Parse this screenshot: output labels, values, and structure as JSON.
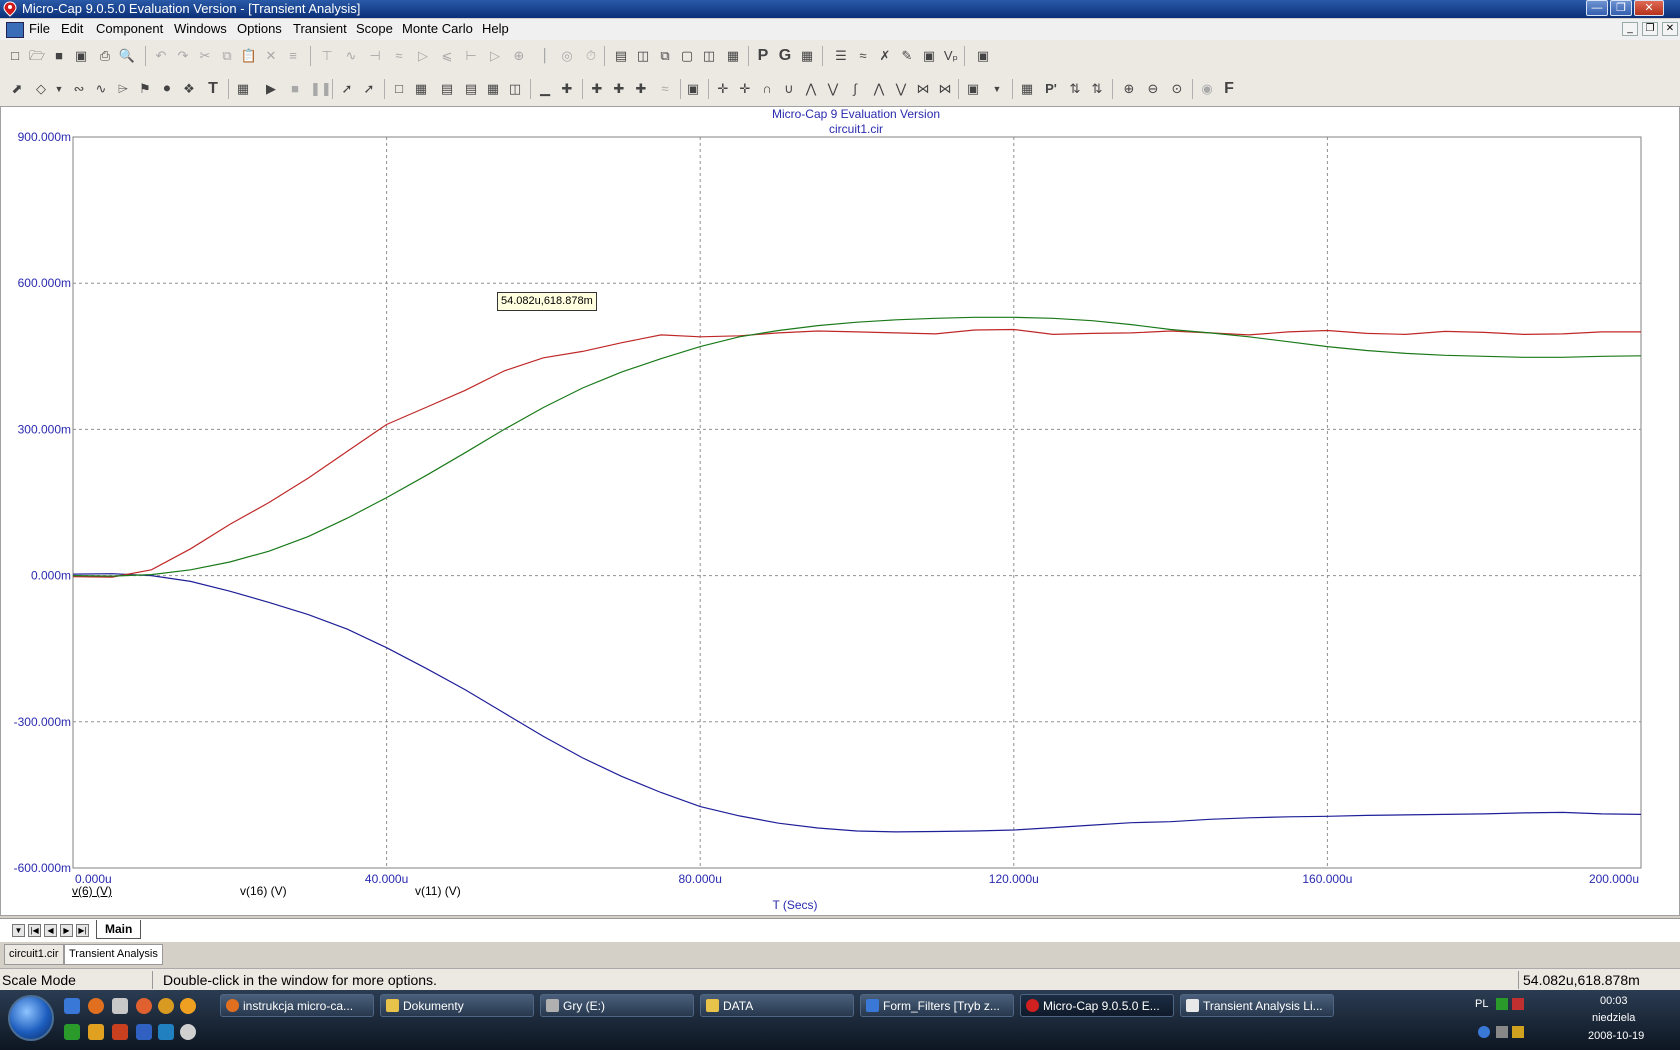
{
  "window": {
    "title": "Micro-Cap 9.0.5.0 Evaluation Version - [Transient Analysis]",
    "controls": [
      "minimize-icon",
      "restore-icon",
      "close-icon"
    ]
  },
  "menu": [
    "File",
    "Edit",
    "Component",
    "Windows",
    "Options",
    "Transient",
    "Scope",
    "Monte Carlo",
    "Help"
  ],
  "plot": {
    "header_line1": "Micro-Cap 9 Evaluation Version",
    "header_line2": "circuit1.cir",
    "cursor_tooltip": "54.082u,618.878m",
    "x_axis_title": "T (Secs)",
    "legend": [
      {
        "label": "v(6) (V)",
        "color": "#2020a0"
      },
      {
        "label": "v(16) (V)",
        "color": "#c03030"
      },
      {
        "label": "v(11) (V)",
        "color": "#208020"
      }
    ]
  },
  "chart_data": {
    "type": "line",
    "title": "Micro-Cap 9 Evaluation Version",
    "subtitle": "circuit1.cir",
    "xlabel": "T (Secs)",
    "ylabel": "",
    "xlim": [
      0,
      200
    ],
    "ylim": [
      -600,
      900
    ],
    "x_unit": "u",
    "y_unit": "m",
    "x_ticks": [
      "0.000u",
      "40.000u",
      "80.000u",
      "120.000u",
      "160.000u",
      "200.000u"
    ],
    "x_tick_values": [
      0,
      40,
      80,
      120,
      160,
      200
    ],
    "y_ticks": [
      "900.000m",
      "600.000m",
      "300.000m",
      "0.000m",
      "-300.000m",
      "-600.000m"
    ],
    "y_tick_values": [
      900,
      600,
      300,
      0,
      -300,
      -600
    ],
    "grid": true,
    "series": [
      {
        "name": "v(6) (V)",
        "color": "#1f1f99",
        "x": [
          0,
          5,
          10,
          15,
          20,
          25,
          30,
          35,
          40,
          45,
          50,
          55,
          60,
          65,
          70,
          75,
          80,
          85,
          90,
          95,
          100,
          105,
          110,
          115,
          120,
          125,
          130,
          135,
          140,
          145,
          150,
          155,
          160,
          165,
          170,
          175,
          180,
          185,
          190,
          195,
          200
        ],
        "y": [
          3,
          4,
          0,
          -12,
          -32,
          -55,
          -80,
          -110,
          -148,
          -190,
          -234,
          -282,
          -330,
          -374,
          -412,
          -445,
          -474,
          -493,
          -508,
          -518,
          -524,
          -526,
          -525,
          -524,
          -522,
          -517,
          -512,
          -507,
          -505,
          -500,
          -497,
          -495,
          -494,
          -492,
          -491,
          -490,
          -489,
          -487,
          -486,
          -489,
          -490
        ]
      },
      {
        "name": "v(16) (V)",
        "color": "#c02828",
        "x": [
          0,
          5,
          10,
          15,
          20,
          25,
          30,
          35,
          40,
          45,
          50,
          55,
          60,
          65,
          70,
          75,
          80,
          85,
          90,
          95,
          100,
          105,
          110,
          115,
          120,
          125,
          130,
          135,
          140,
          145,
          150,
          155,
          160,
          165,
          170,
          175,
          180,
          185,
          190,
          195,
          200
        ],
        "y": [
          -2,
          -3,
          12,
          55,
          105,
          150,
          200,
          255,
          310,
          345,
          380,
          420,
          447,
          460,
          478,
          494,
          490,
          492,
          498,
          502,
          500,
          498,
          496,
          504,
          505,
          495,
          497,
          498,
          502,
          498,
          494,
          500,
          503,
          497,
          495,
          501,
          499,
          495,
          496,
          500,
          500
        ]
      },
      {
        "name": "v(11) (V)",
        "color": "#1a7a1a",
        "x": [
          0,
          5,
          10,
          15,
          20,
          25,
          30,
          35,
          40,
          45,
          50,
          55,
          60,
          65,
          70,
          75,
          80,
          85,
          90,
          95,
          100,
          105,
          110,
          115,
          120,
          125,
          130,
          135,
          140,
          145,
          150,
          155,
          160,
          165,
          170,
          175,
          180,
          185,
          190,
          195,
          200
        ],
        "y": [
          0,
          -1,
          2,
          12,
          28,
          50,
          80,
          118,
          160,
          205,
          252,
          300,
          345,
          385,
          418,
          445,
          470,
          490,
          503,
          513,
          520,
          525,
          528,
          530,
          530,
          528,
          523,
          515,
          505,
          498,
          490,
          480,
          470,
          462,
          456,
          452,
          450,
          448,
          448,
          450,
          451
        ]
      }
    ]
  },
  "page_tabs": {
    "active": "Main"
  },
  "doc_tabs": [
    "circuit1.cir",
    "Transient Analysis"
  ],
  "status": {
    "mode": "Scale Mode",
    "hint": "Double-click in the window for more options.",
    "readout": "54.082u,618.878m"
  },
  "taskbar": {
    "buttons": [
      {
        "label": "instrukcja micro-ca...",
        "icon_color": "#e07020"
      },
      {
        "label": "Dokumenty",
        "icon_color": "#e8c34a"
      },
      {
        "label": "Gry (E:)",
        "icon_color": "#b0b0b0"
      },
      {
        "label": "DATA",
        "icon_color": "#e8c34a"
      },
      {
        "label": "Form_Filters [Tryb z...",
        "icon_color": "#3a78d8"
      },
      {
        "label": "Micro-Cap 9.0.5.0 E...",
        "icon_color": "#d02020"
      },
      {
        "label": "Transient Analysis Li...",
        "icon_color": "#e8e8e8"
      }
    ],
    "tray": {
      "language": "PL",
      "time": "00:03",
      "day": "niedziela",
      "date": "2008-10-19"
    }
  }
}
